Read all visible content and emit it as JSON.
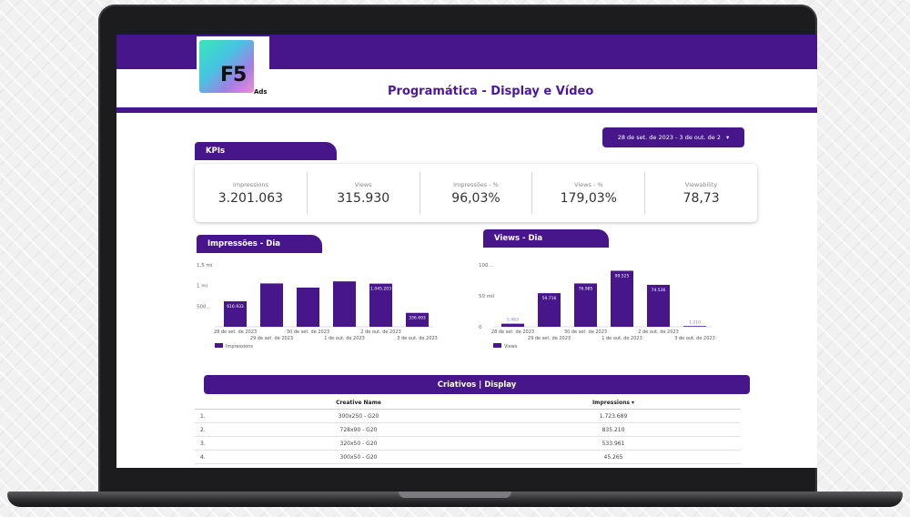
{
  "header": {
    "logo_text": "F5",
    "logo_sub": "Ads",
    "title": "Programática - Display e Vídeo"
  },
  "date_filter": {
    "label": "28 de set. de 2023 - 3 de out. de 2",
    "arrow": "▾"
  },
  "kpis": {
    "section_title": "KPIs",
    "items": [
      {
        "label": "Impressions",
        "value": "3.201.063"
      },
      {
        "label": "Views",
        "value": "315.930"
      },
      {
        "label": "Impressões - %",
        "value": "96,03%"
      },
      {
        "label": "Views - %",
        "value": "179,03%"
      },
      {
        "label": "Viewability",
        "value": "78,73"
      }
    ]
  },
  "chart_data": [
    {
      "type": "bar",
      "title": "Impressões - Dia",
      "y_ticks": [
        "1,5 mi",
        "1 mi",
        "500..."
      ],
      "ylim": [
        0,
        1500000
      ],
      "categories": [
        "28 de set. de 2023",
        "29 de set. de 2023",
        "30 de set. de 2023",
        "1 de out. de 2023",
        "2 de out. de 2023",
        "3 de out. de 2023"
      ],
      "values": [
        616933,
        1050000,
        950000,
        1100000,
        1045203,
        336693
      ],
      "data_labels": [
        "616.933",
        "",
        "",
        "",
        "1.045.203",
        "336.693"
      ],
      "series": [
        {
          "name": "Impressions",
          "color": "#47168a"
        }
      ],
      "legend": "bottom-left"
    },
    {
      "type": "bar",
      "title": "Views - Dia",
      "y_ticks": [
        "100...",
        "50 mil",
        "0"
      ],
      "ylim": [
        0,
        110000
      ],
      "categories": [
        "28 de set. de 2023",
        "29 de set. de 2023",
        "30 de set. de 2023",
        "1 de out. de 2023",
        "2 de out. de 2023",
        "3 de out. de 2023"
      ],
      "values": [
        5463,
        59716,
        76985,
        99525,
        74536,
        1210
      ],
      "data_labels": [
        "5.463",
        "59.716",
        "76.985",
        "99.525",
        "74.536",
        "1.210"
      ],
      "series": [
        {
          "name": "Views",
          "color": "#47168a"
        }
      ],
      "legend": "bottom-left"
    }
  ],
  "creatives": {
    "title": "Criativos |  Display",
    "columns": [
      "Creative Name",
      "Impressions ▾"
    ],
    "rows": [
      {
        "idx": "1.",
        "name": "300x250 - G20",
        "impressions": "1.723.689"
      },
      {
        "idx": "2.",
        "name": "728x90 - G20",
        "impressions": "835.210"
      },
      {
        "idx": "3.",
        "name": "320x50 - G20",
        "impressions": "533.961"
      },
      {
        "idx": "4.",
        "name": "300x50 - G20",
        "impressions": "45.265"
      }
    ]
  },
  "colors": {
    "brand": "#47168a",
    "title_text": "#4a189a",
    "bar": "#47168a"
  }
}
